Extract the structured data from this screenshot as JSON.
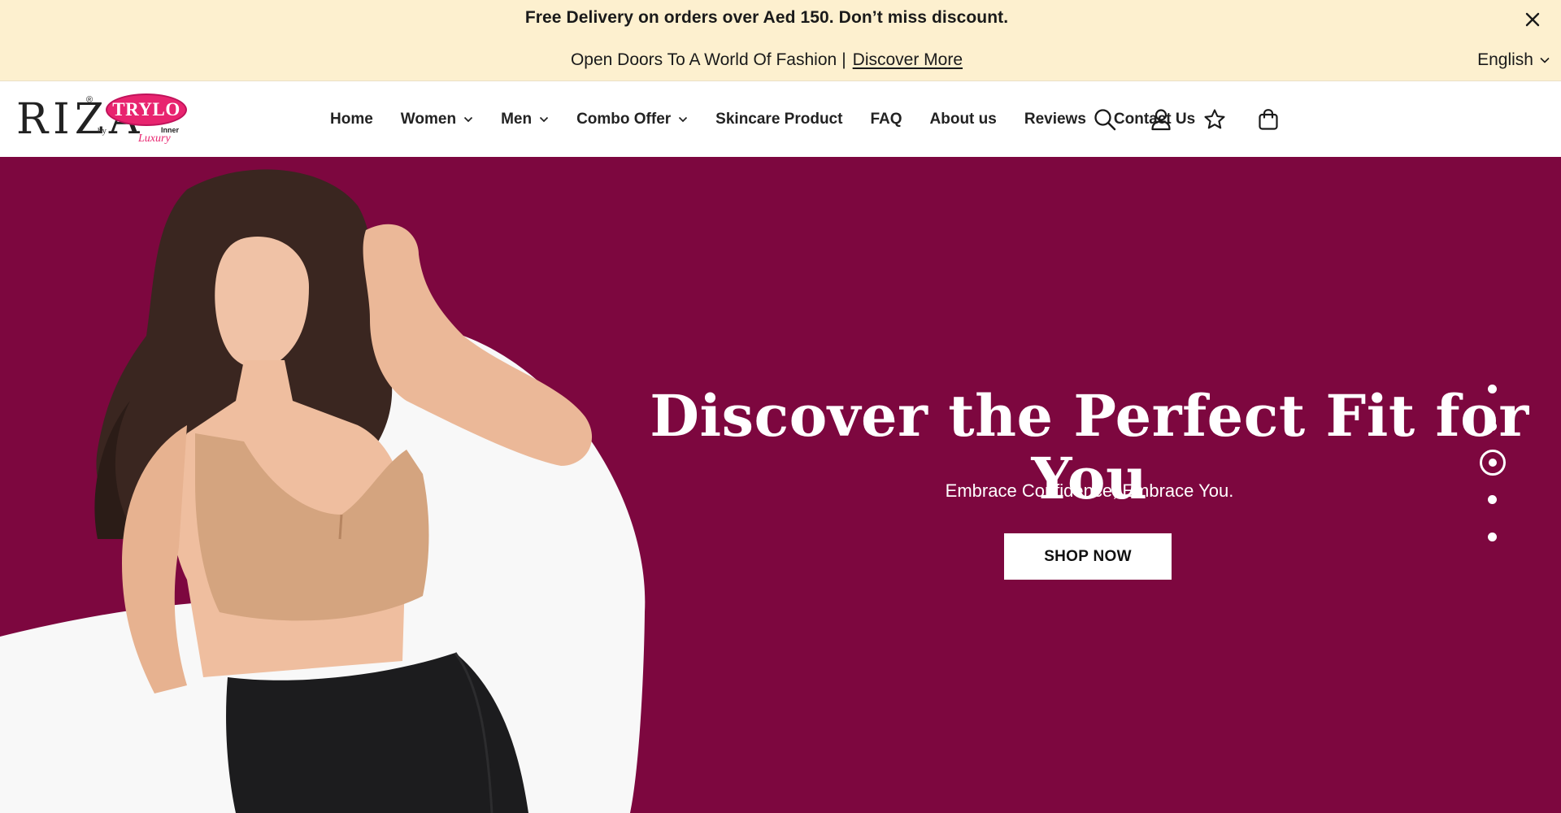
{
  "announcement": {
    "line1": "Free Delivery on orders over Aed 150. Don’t miss discount.",
    "line2_text": "Open Doors To A World Of Fashion",
    "line2_separator": "|",
    "line2_link": "Discover More",
    "close_icon": "close-icon",
    "background": "#fdf0cf"
  },
  "language": {
    "selected": "English",
    "icon": "chevron-down-icon"
  },
  "logo": {
    "brand": "RIZA",
    "registered": "®",
    "by": "by",
    "partner": "TRYLO",
    "partner_tag_top": "Inner",
    "partner_tag_bottom": "Luxury",
    "accent": "#e8246f"
  },
  "nav": {
    "items": [
      {
        "label": "Home",
        "dropdown": false
      },
      {
        "label": "Women",
        "dropdown": true
      },
      {
        "label": "Men",
        "dropdown": true
      },
      {
        "label": "Combo Offer",
        "dropdown": true
      },
      {
        "label": "Skincare Product",
        "dropdown": false
      },
      {
        "label": "FAQ",
        "dropdown": false
      },
      {
        "label": "About us",
        "dropdown": false
      },
      {
        "label": "Reviews",
        "dropdown": false
      },
      {
        "label": "Contact Us",
        "dropdown": false
      }
    ]
  },
  "header_icons": [
    "search-icon",
    "user-icon",
    "wishlist-star-icon",
    "cart-bag-icon"
  ],
  "hero": {
    "title": "Discover the Perfect Fit for You",
    "subtitle": "Embrace Confidence, Embrace You.",
    "cta": "SHOP NOW",
    "background": "#7d073f",
    "slides_count": 5,
    "active_slide": 3
  }
}
